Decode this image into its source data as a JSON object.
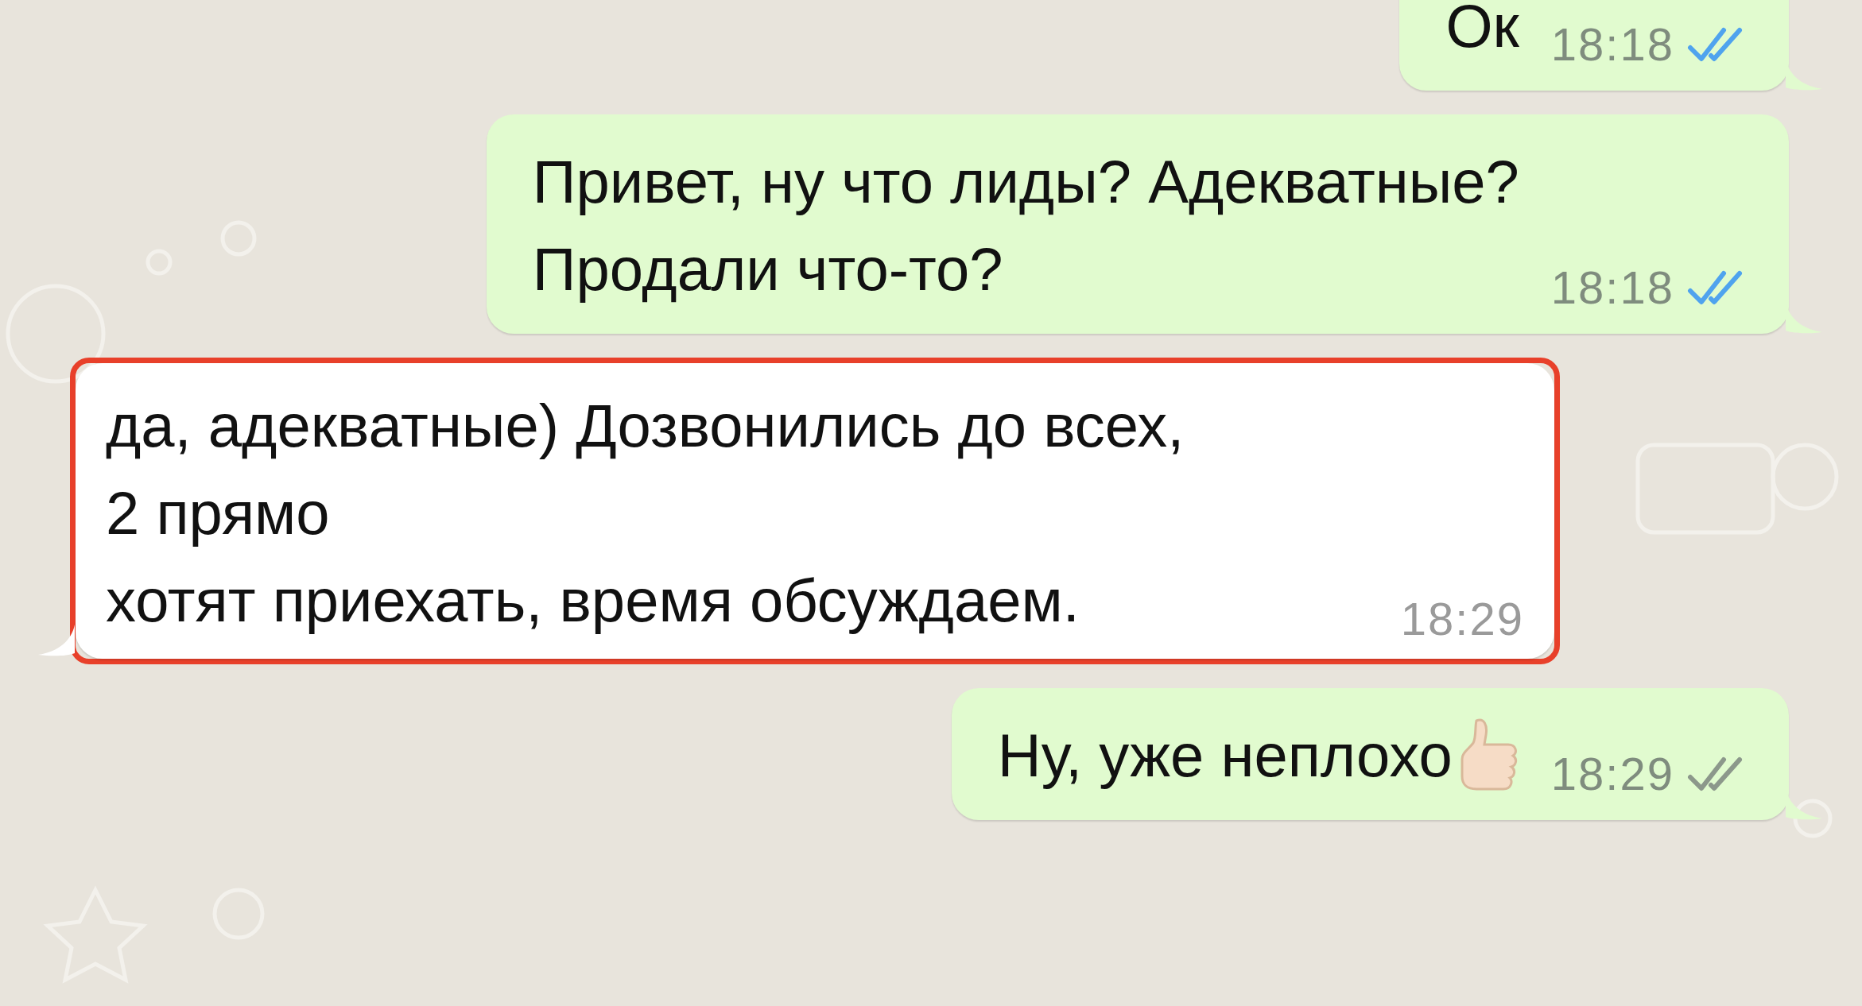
{
  "messages": [
    {
      "kind": "outgoing",
      "text": "Ок",
      "time": "18:18",
      "read": true,
      "highlighted": false,
      "emoji": false
    },
    {
      "kind": "outgoing",
      "text": "Привет, ну что лиды? Адекватные?\nПродали что-то?",
      "time": "18:18",
      "read": true,
      "highlighted": false,
      "emoji": false
    },
    {
      "kind": "incoming",
      "text": "да, адекватные) Дозвонились до всех,\n2 прямо\nхотят приехать, время обсуждаем.",
      "time": "18:29",
      "highlighted": true,
      "emoji": false
    },
    {
      "kind": "outgoing",
      "text": "Ну, уже неплохо",
      "time": "18:29",
      "read": false,
      "highlighted": false,
      "emoji": true
    }
  ]
}
